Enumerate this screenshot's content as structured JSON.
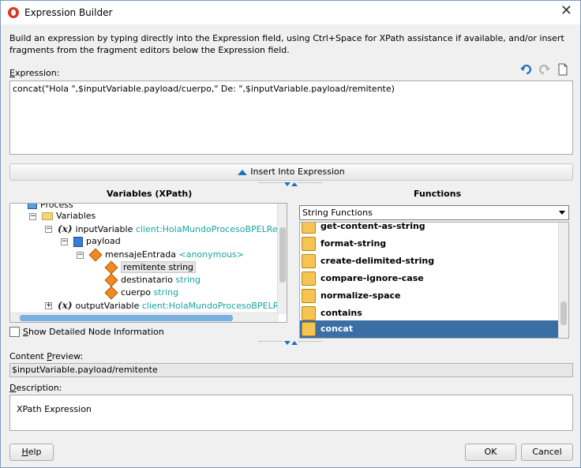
{
  "window": {
    "title": "Expression Builder"
  },
  "intro": "Build an expression by typing directly into the Expression field, using Ctrl+Space for XPath assistance if available, and/or insert fragments from the fragment editors below the Expression field.",
  "expression": {
    "label_prefix": "E",
    "label_rest": "xpression:",
    "value": "concat(\"Hola \",$inputVariable.payload/cuerpo,\" De: \",$inputVariable.payload/remitente)",
    "tools": [
      "undo-icon",
      "redo-icon",
      "new-document-icon"
    ]
  },
  "insert_button": "Insert Into Expression",
  "variables": {
    "title": "Variables (XPath)",
    "tree": [
      {
        "label": "Process",
        "type": ""
      },
      {
        "label": "Variables",
        "type": ""
      },
      {
        "label": "inputVariable",
        "type": "client:HolaMundoProcesoBPELRequestM"
      },
      {
        "label": "payload",
        "type": ""
      },
      {
        "label": "mensajeEntrada",
        "type": "<anonymous>"
      },
      {
        "label": "remitente",
        "type": "string"
      },
      {
        "label": "destinatario",
        "type": "string"
      },
      {
        "label": "cuerpo",
        "type": "string"
      },
      {
        "label": "outputVariable",
        "type": "client:HolaMundoProcesoBPELRespons"
      }
    ],
    "show_detail_prefix": "S",
    "show_detail_rest": "how Detailed Node Information"
  },
  "functions": {
    "title": "Functions",
    "category": "String Functions",
    "items": [
      "get-content-as-string",
      "format-string",
      "create-delimited-string",
      "compare-ignore-case",
      "normalize-space",
      "contains",
      "concat"
    ],
    "selected": "concat"
  },
  "content_preview": {
    "label_prefix": "Content ",
    "label_u": "P",
    "label_rest": "review:",
    "value": "$inputVariable.payload/remitente"
  },
  "description": {
    "label_prefix": "D",
    "label_rest": "escription:",
    "value": "XPath Expression"
  },
  "buttons": {
    "help_u": "H",
    "help_rest": "elp",
    "ok": "OK",
    "cancel": "Cancel"
  },
  "colors": {
    "selection": "#3b6ea5",
    "type_text": "#1aa3a3",
    "accent_arrow": "#1e6fc2"
  }
}
